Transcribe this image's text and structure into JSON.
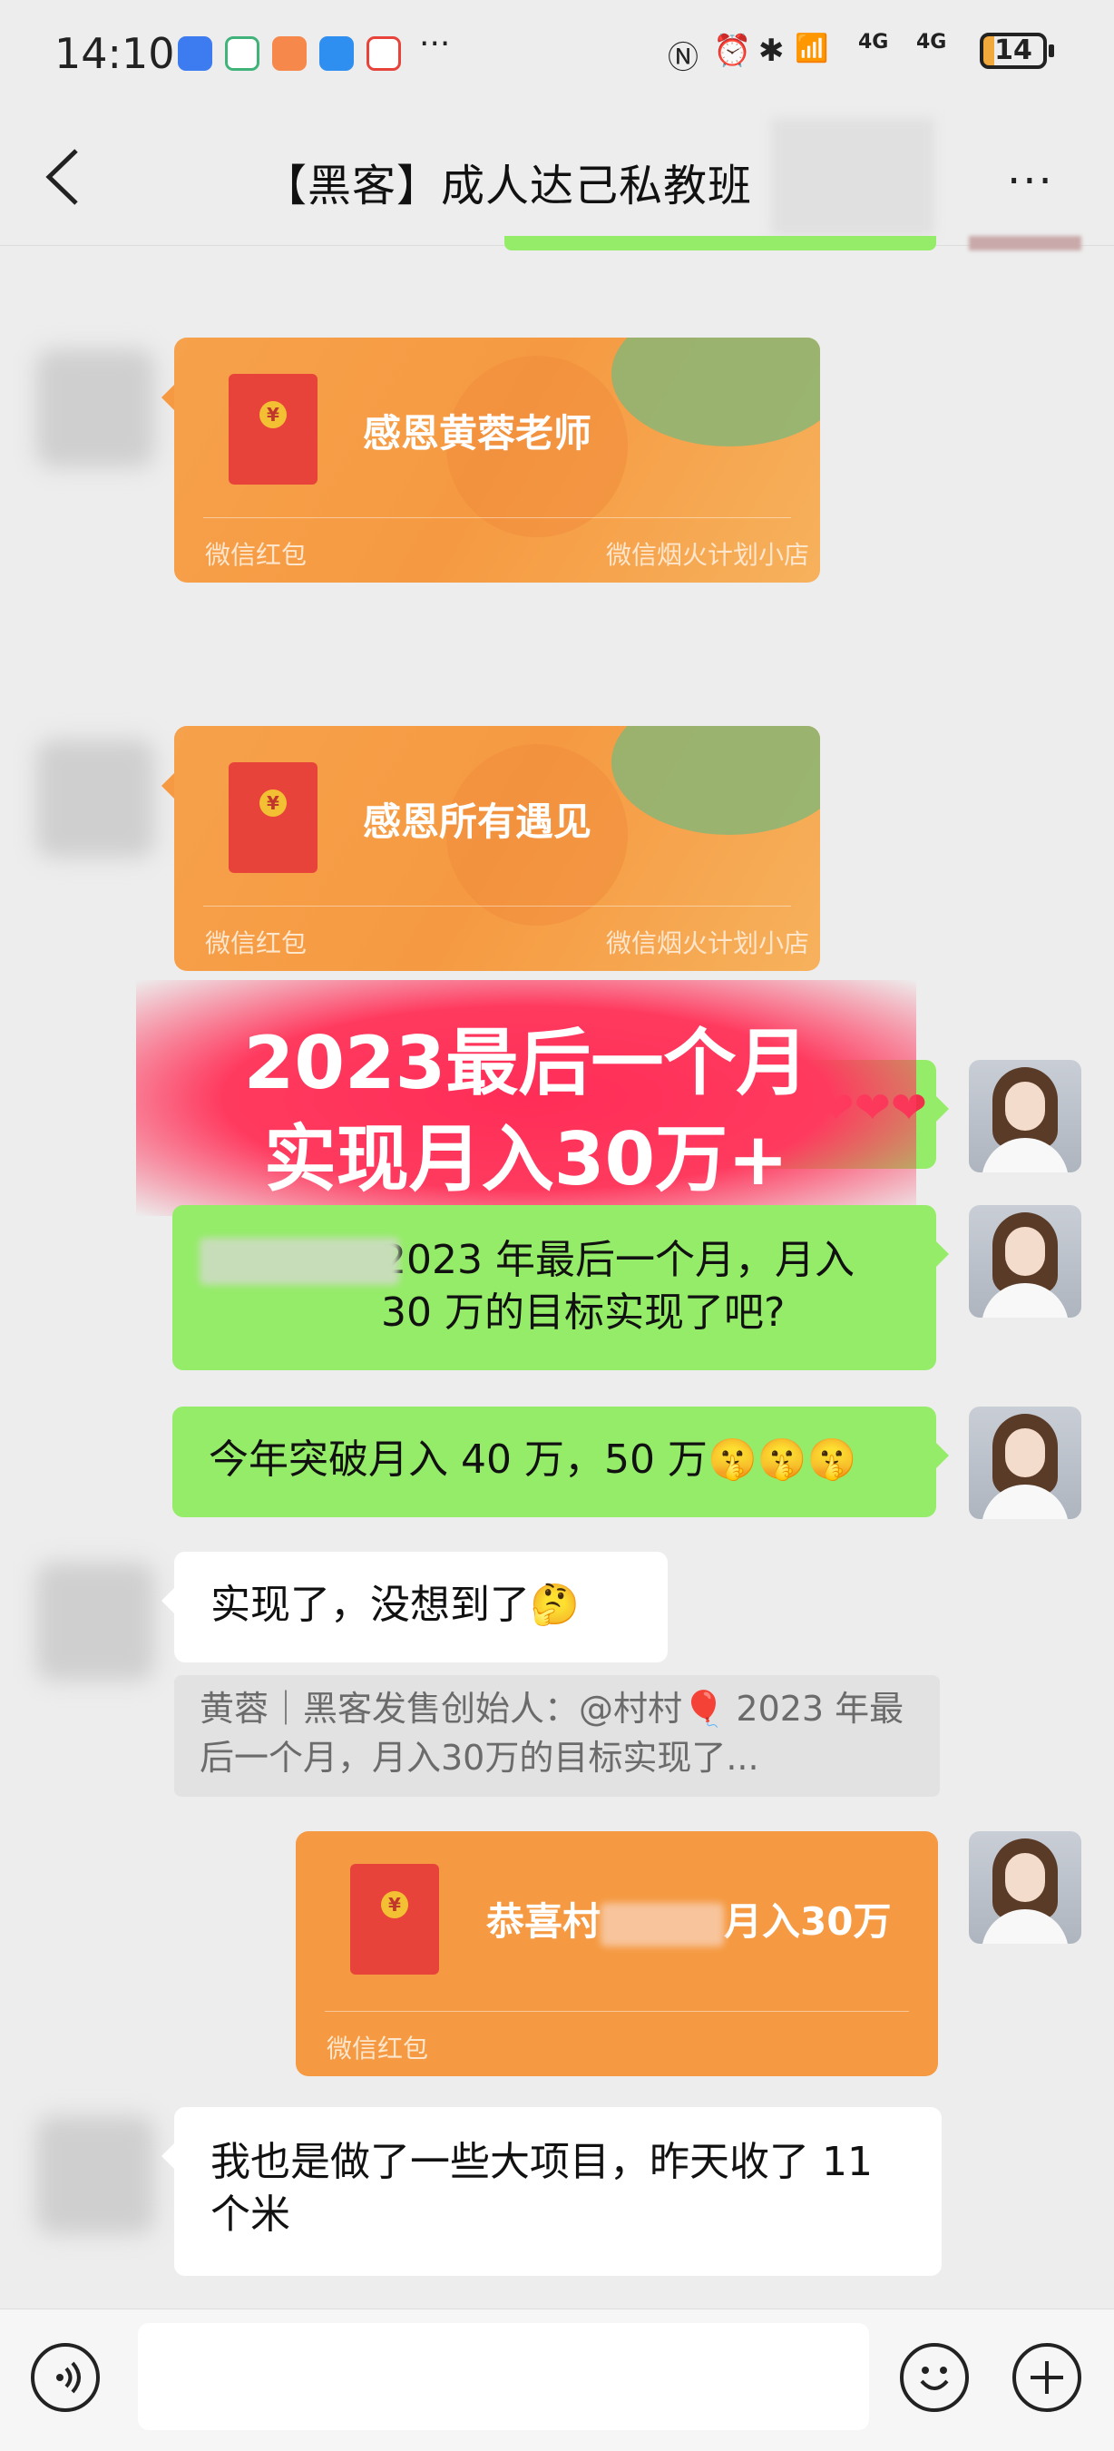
{
  "status_bar": {
    "time": "14:10",
    "more": "···",
    "network": "4G",
    "battery": "14"
  },
  "nav": {
    "title": "【黑客】成人达己私教班",
    "more": "···"
  },
  "messages": {
    "red_packet_1": {
      "greeting": "感恩黄蓉老师",
      "footer_left": "微信红包",
      "footer_right": "微信烟火计划小店"
    },
    "red_packet_2": {
      "greeting": "感恩所有遇见",
      "footer_left": "微信红包",
      "footer_right": "微信烟火计划小店"
    },
    "hearts": "❤❤❤",
    "msg_2023": "2023 年最后一个月，月入 30 万的目标实现了吧?",
    "msg_break": "今年突破月入 40 万，50 万",
    "msg_break_emoji": "🤫🤫🤫",
    "msg_reply": "实现了，没想到了",
    "msg_reply_emoji": "🤔",
    "quote": "黄蓉｜黑客发售创始人：@村村🎈 2023 年最后一个月，月入30万的目标实现了...",
    "red_packet_3": {
      "greeting_prefix": "恭喜村",
      "greeting_suffix": "月入30万",
      "footer_left": "微信红包"
    },
    "msg_last": "我也是做了一些大项目，昨天收了 11 个米"
  },
  "banner": {
    "line1": "2023最后一个月",
    "line2": "实现月入30万+"
  },
  "colors": {
    "green_bubble": "#95ec69",
    "red_packet": "#f59a42",
    "banner": "#ff2d57"
  },
  "icons": [
    "voice-icon",
    "emoji-icon",
    "plus-icon",
    "back-icon",
    "more-icon"
  ]
}
